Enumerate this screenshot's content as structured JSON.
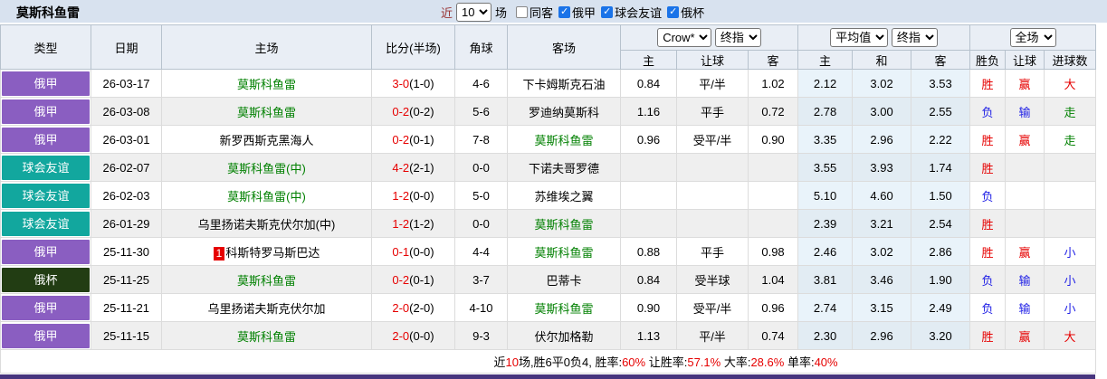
{
  "self_keyword": "莫斯科鱼雷",
  "topbar": {
    "title": "莫斯科鱼雷",
    "recent_label": "近",
    "recent_value": "10",
    "games_label": "场",
    "checkboxes": [
      {
        "label": "同客",
        "checked": false
      },
      {
        "label": "俄甲",
        "checked": true
      },
      {
        "label": "球会友谊",
        "checked": true
      },
      {
        "label": "俄杯",
        "checked": true
      }
    ]
  },
  "header": {
    "columns": [
      "类型",
      "日期",
      "主场",
      "比分(半场)",
      "角球",
      "客场"
    ],
    "selects": {
      "bookmaker": "Crow*",
      "bookmaker_final": "终指",
      "average": "平均值",
      "average_final": "终指",
      "scope": "全场"
    },
    "sub_columns": [
      "主",
      "让球",
      "客",
      "主",
      "和",
      "客",
      "胜负",
      "让球",
      "进球数"
    ]
  },
  "rows": [
    {
      "league": "俄甲",
      "date": "26-03-17",
      "home": "莫斯科鱼雷",
      "badge": "",
      "score": "3-0",
      "half": "(1-0)",
      "corner": "4-6",
      "away": "下卡姆斯克石油",
      "crow": [
        "0.84",
        "平/半",
        "1.02"
      ],
      "avg": [
        "2.12",
        "3.02",
        "3.53"
      ],
      "result": [
        "胜",
        "赢",
        "大"
      ]
    },
    {
      "league": "俄甲",
      "date": "26-03-08",
      "home": "莫斯科鱼雷",
      "badge": "",
      "score": "0-2",
      "half": "(0-2)",
      "corner": "5-6",
      "away": "罗迪纳莫斯科",
      "crow": [
        "1.16",
        "平手",
        "0.72"
      ],
      "avg": [
        "2.78",
        "3.00",
        "2.55"
      ],
      "result": [
        "负",
        "输",
        "走"
      ]
    },
    {
      "league": "俄甲",
      "date": "26-03-01",
      "home": "新罗西斯克黑海人",
      "badge": "",
      "score": "0-2",
      "half": "(0-1)",
      "corner": "7-8",
      "away": "莫斯科鱼雷",
      "crow": [
        "0.96",
        "受平/半",
        "0.90"
      ],
      "avg": [
        "3.35",
        "2.96",
        "2.22"
      ],
      "result": [
        "胜",
        "赢",
        "走"
      ]
    },
    {
      "league": "球会友谊",
      "date": "26-02-07",
      "home": "莫斯科鱼雷(中)",
      "badge": "",
      "score": "4-2",
      "half": "(2-1)",
      "corner": "0-0",
      "away": "下诺夫哥罗德",
      "crow": [
        "",
        "",
        ""
      ],
      "avg": [
        "3.55",
        "3.93",
        "1.74"
      ],
      "result": [
        "胜",
        "",
        ""
      ]
    },
    {
      "league": "球会友谊",
      "date": "26-02-03",
      "home": "莫斯科鱼雷(中)",
      "badge": "",
      "score": "1-2",
      "half": "(0-0)",
      "corner": "5-0",
      "away": "苏维埃之翼",
      "crow": [
        "",
        "",
        ""
      ],
      "avg": [
        "5.10",
        "4.60",
        "1.50"
      ],
      "result": [
        "负",
        "",
        ""
      ]
    },
    {
      "league": "球会友谊",
      "date": "26-01-29",
      "home": "乌里扬诺夫斯克伏尔加(中)",
      "badge": "",
      "score": "1-2",
      "half": "(1-2)",
      "corner": "0-0",
      "away": "莫斯科鱼雷",
      "crow": [
        "",
        "",
        ""
      ],
      "avg": [
        "2.39",
        "3.21",
        "2.54"
      ],
      "result": [
        "胜",
        "",
        ""
      ]
    },
    {
      "league": "俄甲",
      "date": "25-11-30",
      "home": "科斯特罗马斯巴达",
      "badge": "1",
      "score": "0-1",
      "half": "(0-0)",
      "corner": "4-4",
      "away": "莫斯科鱼雷",
      "crow": [
        "0.88",
        "平手",
        "0.98"
      ],
      "avg": [
        "2.46",
        "3.02",
        "2.86"
      ],
      "result": [
        "胜",
        "赢",
        "小"
      ]
    },
    {
      "league": "俄杯",
      "date": "25-11-25",
      "home": "莫斯科鱼雷",
      "badge": "",
      "score": "0-2",
      "half": "(0-1)",
      "corner": "3-7",
      "away": "巴蒂卡",
      "crow": [
        "0.84",
        "受半球",
        "1.04"
      ],
      "avg": [
        "3.81",
        "3.46",
        "1.90"
      ],
      "result": [
        "负",
        "输",
        "小"
      ]
    },
    {
      "league": "俄甲",
      "date": "25-11-21",
      "home": "乌里扬诺夫斯克伏尔加",
      "badge": "",
      "score": "2-0",
      "half": "(2-0)",
      "corner": "4-10",
      "away": "莫斯科鱼雷",
      "crow": [
        "0.90",
        "受平/半",
        "0.96"
      ],
      "avg": [
        "2.74",
        "3.15",
        "2.49"
      ],
      "result": [
        "负",
        "输",
        "小"
      ]
    },
    {
      "league": "俄甲",
      "date": "25-11-15",
      "home": "莫斯科鱼雷",
      "badge": "",
      "score": "2-0",
      "half": "(0-0)",
      "corner": "9-3",
      "away": "伏尔加格勒",
      "crow": [
        "1.13",
        "平/半",
        "0.74"
      ],
      "avg": [
        "2.30",
        "2.96",
        "3.20"
      ],
      "result": [
        "胜",
        "赢",
        "大"
      ]
    }
  ],
  "footer": {
    "segments": [
      {
        "text": "近",
        "hl": false
      },
      {
        "text": "10",
        "hl": true
      },
      {
        "text": "场,胜6平0负4, 胜率:",
        "hl": false
      },
      {
        "text": "60%",
        "hl": true
      },
      {
        "text": " 让胜率:",
        "hl": false
      },
      {
        "text": "57.1%",
        "hl": true
      },
      {
        "text": " 大率:",
        "hl": false
      },
      {
        "text": "28.6%",
        "hl": true
      },
      {
        "text": " 单率:",
        "hl": false
      },
      {
        "text": "40%",
        "hl": true
      }
    ]
  },
  "colors": {
    "league": {
      "俄甲": "#8a5ec1",
      "球会友谊": "#12a79e",
      "俄杯": "#223d13"
    },
    "result": {
      "胜": "#e60000",
      "赢": "#e60000",
      "大": "#e60000",
      "负": "#2222e6",
      "输": "#2222e6",
      "小": "#2222e6",
      "走": "#008000"
    },
    "self_team": "#008000",
    "score": "#e60000",
    "badge_bg": "#e60000",
    "footer_highlight": "#e60000",
    "topbar_bg": "#d8e2ef",
    "bottombar_bg": "#47357e"
  }
}
